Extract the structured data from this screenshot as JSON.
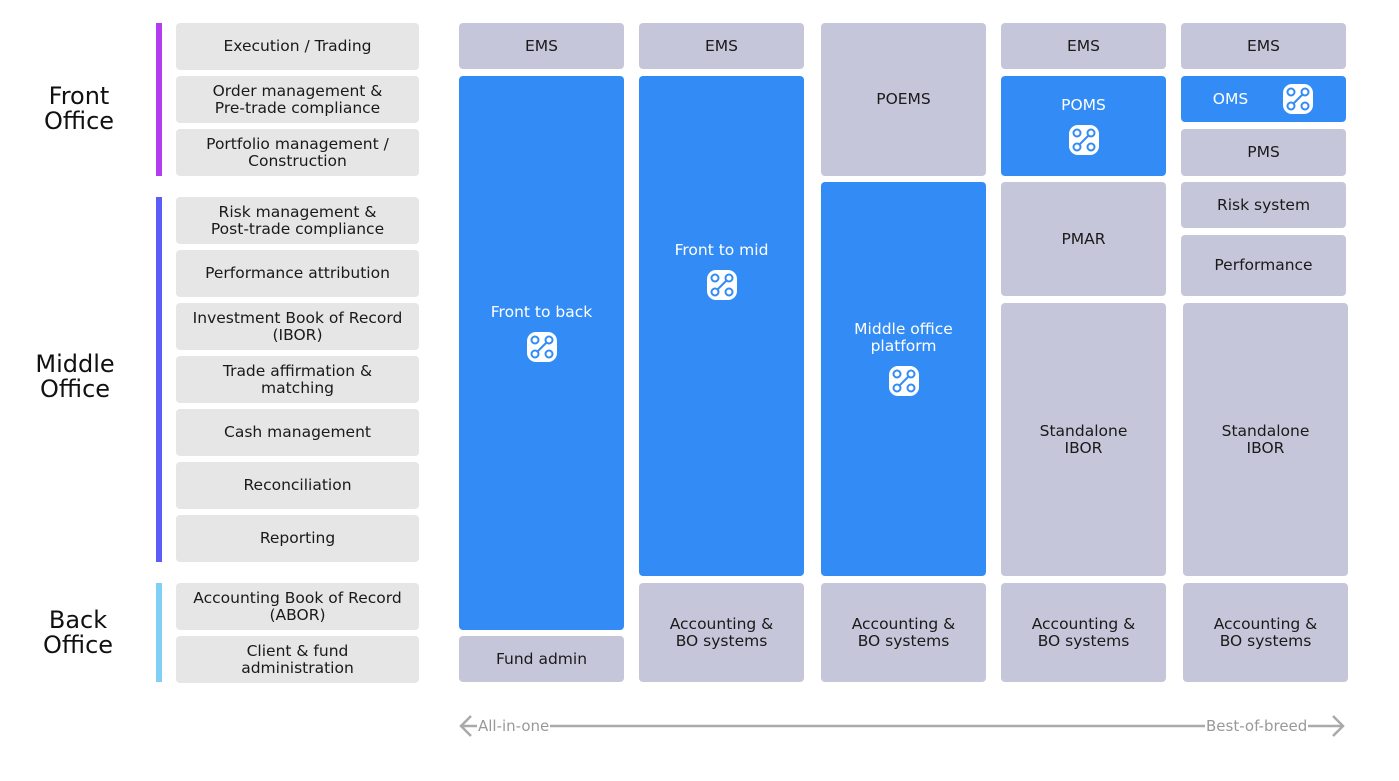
{
  "sections": {
    "front": "Front\nOffice",
    "middle": "Middle\nOffice",
    "back": "Back\nOffice"
  },
  "functions": [
    "Execution / Trading",
    "Order management &\nPre-trade compliance",
    "Portfolio management /\nConstruction",
    "Risk management &\nPost-trade compliance",
    "Performance attribution",
    "Investment Book of Record\n(IBOR)",
    "Trade affirmation &\nmatching",
    "Cash management",
    "Reconciliation",
    "Reporting",
    "Accounting Book of Record\n(ABOR)",
    "Client & fund\nadministration"
  ],
  "columns": [
    {
      "boxes": [
        "EMS",
        "Front to back",
        "Fund admin"
      ]
    },
    {
      "boxes": [
        "EMS",
        "Front to mid",
        "Accounting &\nBO systems"
      ]
    },
    {
      "boxes": [
        "POEMS",
        "Middle office\nplatform",
        "Accounting &\nBO systems"
      ]
    },
    {
      "boxes": [
        "EMS",
        "POMS",
        "PMAR",
        "Standalone\nIBOR",
        "Accounting &\nBO systems"
      ]
    },
    {
      "boxes": [
        "EMS",
        "OMS",
        "PMS",
        "Risk system",
        "Performance",
        "Standalone\nIBOR",
        "Accounting &\nBO systems"
      ]
    }
  ],
  "axis": {
    "left": "All-in-one",
    "right": "Best-of-breed"
  },
  "colors": {
    "blue": "#338cf5",
    "gray": "#c6c6da",
    "front": "#b43cf0",
    "middle": "#5c5cf7",
    "back": "#80d0f5"
  },
  "icons": {
    "platform": "integration-icon"
  }
}
